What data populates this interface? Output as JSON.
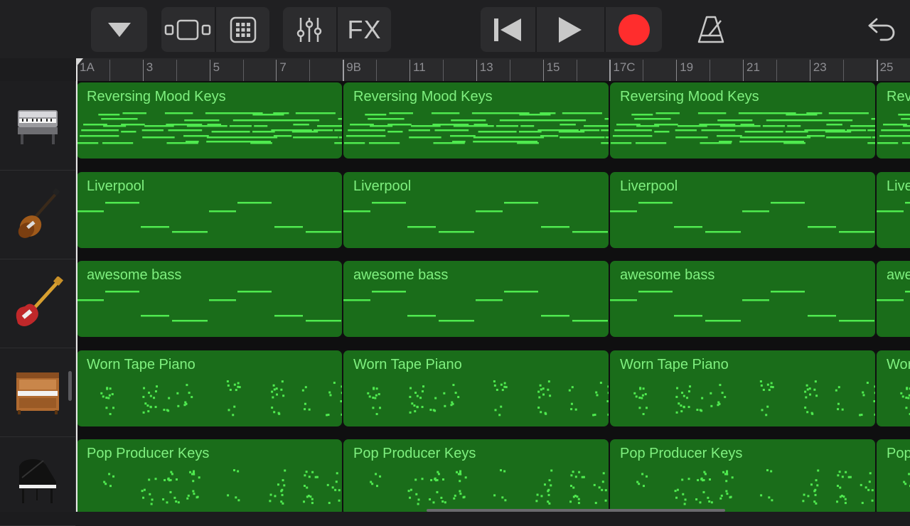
{
  "colors": {
    "region_fill": "#1a6d1a",
    "region_label": "#7ff07f",
    "note": "#4fea4f",
    "record": "#ff2d2d"
  },
  "toolbar": {
    "buttons": [
      {
        "name": "browser-menu",
        "icon": "triangle-down-icon"
      },
      {
        "name": "tracks-view",
        "icon": "tracks-view-icon"
      },
      {
        "name": "instrument-view",
        "icon": "grid-keys-icon"
      },
      {
        "name": "mixer",
        "icon": "mixer-sliders-icon"
      },
      {
        "name": "fx",
        "icon": "fx-icon"
      },
      {
        "name": "go-to-beginning",
        "icon": "skip-back-icon"
      },
      {
        "name": "play",
        "icon": "play-icon"
      },
      {
        "name": "record",
        "icon": "record-icon"
      },
      {
        "name": "metronome",
        "icon": "metronome-icon"
      },
      {
        "name": "undo",
        "icon": "undo-icon"
      }
    ],
    "fx_label": "FX"
  },
  "ruler": {
    "labels": [
      "1A",
      "3",
      "5",
      "7",
      "9B",
      "11",
      "13",
      "15",
      "17C",
      "19",
      "21",
      "23",
      "25"
    ]
  },
  "tracks": [
    {
      "instrument_icon": "electric-piano-icon",
      "region_name": "Reversing Mood Keys",
      "pattern": "keys"
    },
    {
      "instrument_icon": "violin-bass-icon",
      "region_name": "Liverpool",
      "pattern": "bass"
    },
    {
      "instrument_icon": "electric-bass-icon",
      "region_name": "awesome bass",
      "pattern": "bass"
    },
    {
      "instrument_icon": "upright-piano-icon",
      "region_name": "Worn Tape Piano",
      "pattern": "dots"
    },
    {
      "instrument_icon": "grand-piano-icon",
      "region_name": "Pop Producer Keys",
      "pattern": "dots"
    }
  ]
}
